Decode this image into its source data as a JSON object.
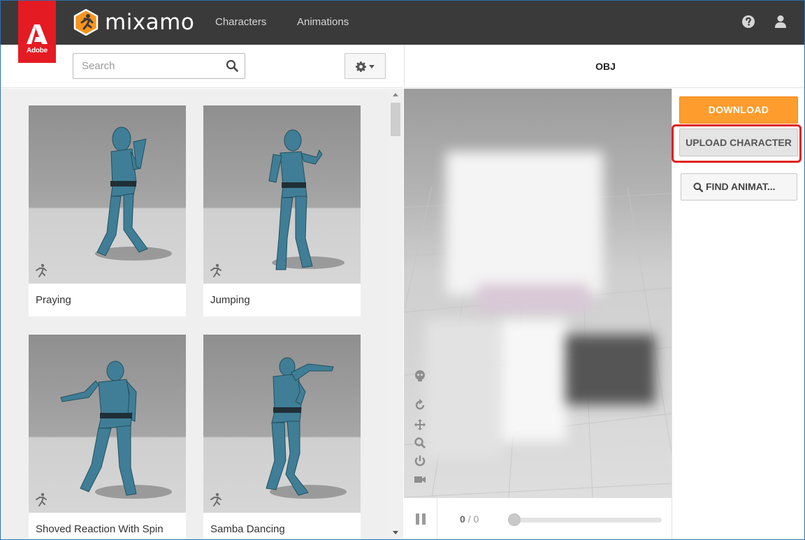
{
  "nav": {
    "adobe_label": "Adobe",
    "brand": "mixamo",
    "links": [
      {
        "label": "Characters"
      },
      {
        "label": "Animations"
      }
    ],
    "icons": [
      "help-icon",
      "user-icon"
    ]
  },
  "search": {
    "placeholder": "Search",
    "value": ""
  },
  "animations": [
    {
      "name": "Praying",
      "icon": "running-figure-icon"
    },
    {
      "name": "Jumping",
      "icon": "running-figure-icon"
    },
    {
      "name": "Shoved Reaction With Spin",
      "icon": "running-figure-icon"
    },
    {
      "name": "Samba Dancing",
      "icon": "running-figure-icon"
    }
  ],
  "viewer": {
    "model_name": "OBJ",
    "frame_current": "0",
    "frame_total": "/ 0",
    "progress": 0
  },
  "actions": {
    "download_label": "DOWNLOAD",
    "upload_label": "UPLOAD CHARACTER",
    "find_label": "FIND ANIMAT..."
  },
  "colors": {
    "topbar": "#3a3a3a",
    "adobe_red": "#e51b23",
    "mixamo_orange": "#f7941d",
    "download_orange": "#ff9c2e",
    "highlight_red": "#e0201f"
  }
}
